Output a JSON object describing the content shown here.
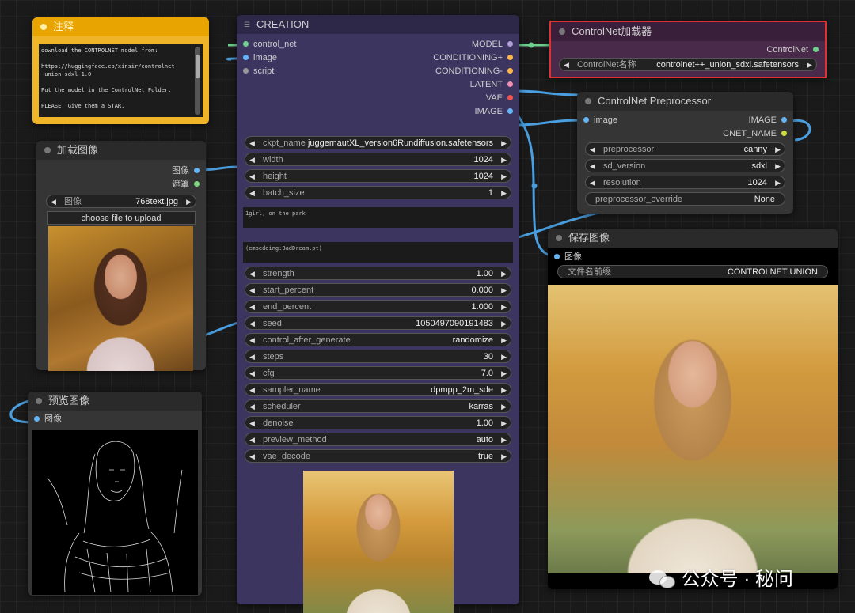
{
  "note": {
    "title": "注释",
    "lines": [
      "download the CONTROLNET model from:",
      "",
      "https://huggingface.co/xinsir/controlnet",
      "-union-sdxl-1.0",
      "",
      "Put the model in the ControlNet Folder.",
      "",
      "PLEASE, Give them a STAR."
    ]
  },
  "load_image": {
    "title": "加载图像",
    "outputs": [
      "图像",
      "遮罩"
    ],
    "widget_label": "图像",
    "widget_value": "768text.jpg",
    "upload_button": "choose file to upload"
  },
  "preview": {
    "title": "预览图像",
    "input": "图像"
  },
  "creation": {
    "title": "CREATION",
    "inputs": [
      "control_net",
      "image",
      "script"
    ],
    "outputs": [
      "MODEL",
      "CONDITIONING+",
      "CONDITIONING-",
      "LATENT",
      "VAE",
      "IMAGE"
    ],
    "widgets_top": [
      {
        "label": "ckpt_name",
        "value": "juggernautXL_version6Rundiffusion.safetensors"
      },
      {
        "label": "width",
        "value": "1024"
      },
      {
        "label": "height",
        "value": "1024"
      },
      {
        "label": "batch_size",
        "value": "1"
      }
    ],
    "positive_prompt": "1girl, on the park",
    "negative_prompt": "(embedding:BadDream.pt)",
    "widgets_bottom": [
      {
        "label": "strength",
        "value": "1.00"
      },
      {
        "label": "start_percent",
        "value": "0.000"
      },
      {
        "label": "end_percent",
        "value": "1.000"
      },
      {
        "label": "seed",
        "value": "1050497090191483"
      },
      {
        "label": "control_after_generate",
        "value": "randomize"
      },
      {
        "label": "steps",
        "value": "30"
      },
      {
        "label": "cfg",
        "value": "7.0"
      },
      {
        "label": "sampler_name",
        "value": "dpmpp_2m_sde"
      },
      {
        "label": "scheduler",
        "value": "karras"
      },
      {
        "label": "denoise",
        "value": "1.00"
      },
      {
        "label": "preview_method",
        "value": "auto"
      },
      {
        "label": "vae_decode",
        "value": "true"
      }
    ]
  },
  "cn_loader": {
    "title": "ControlNet加载器",
    "output": "ControlNet",
    "widget_label": "ControlNet名称",
    "widget_value": "controlnet++_union_sdxl.safetensors"
  },
  "cn_preprocessor": {
    "title": "ControlNet Preprocessor",
    "input": "image",
    "outputs": [
      "IMAGE",
      "CNET_NAME"
    ],
    "widgets": [
      {
        "label": "preprocessor",
        "value": "canny"
      },
      {
        "label": "sd_version",
        "value": "sdxl"
      },
      {
        "label": "resolution",
        "value": "1024"
      },
      {
        "label": "preprocessor_override",
        "value": "None"
      }
    ]
  },
  "save_image": {
    "title": "保存图像",
    "input": "图像",
    "prefix_label": "文件名前缀",
    "prefix_value": "CONTROLNET UNION"
  },
  "watermark": "公众号 · 秘问",
  "colors": {
    "wire": "#4a9fe0",
    "wire_green": "#6fd08f",
    "highlight": "#e03030",
    "creation_bg": "#3b3560",
    "note_bg": "#f0b429"
  }
}
